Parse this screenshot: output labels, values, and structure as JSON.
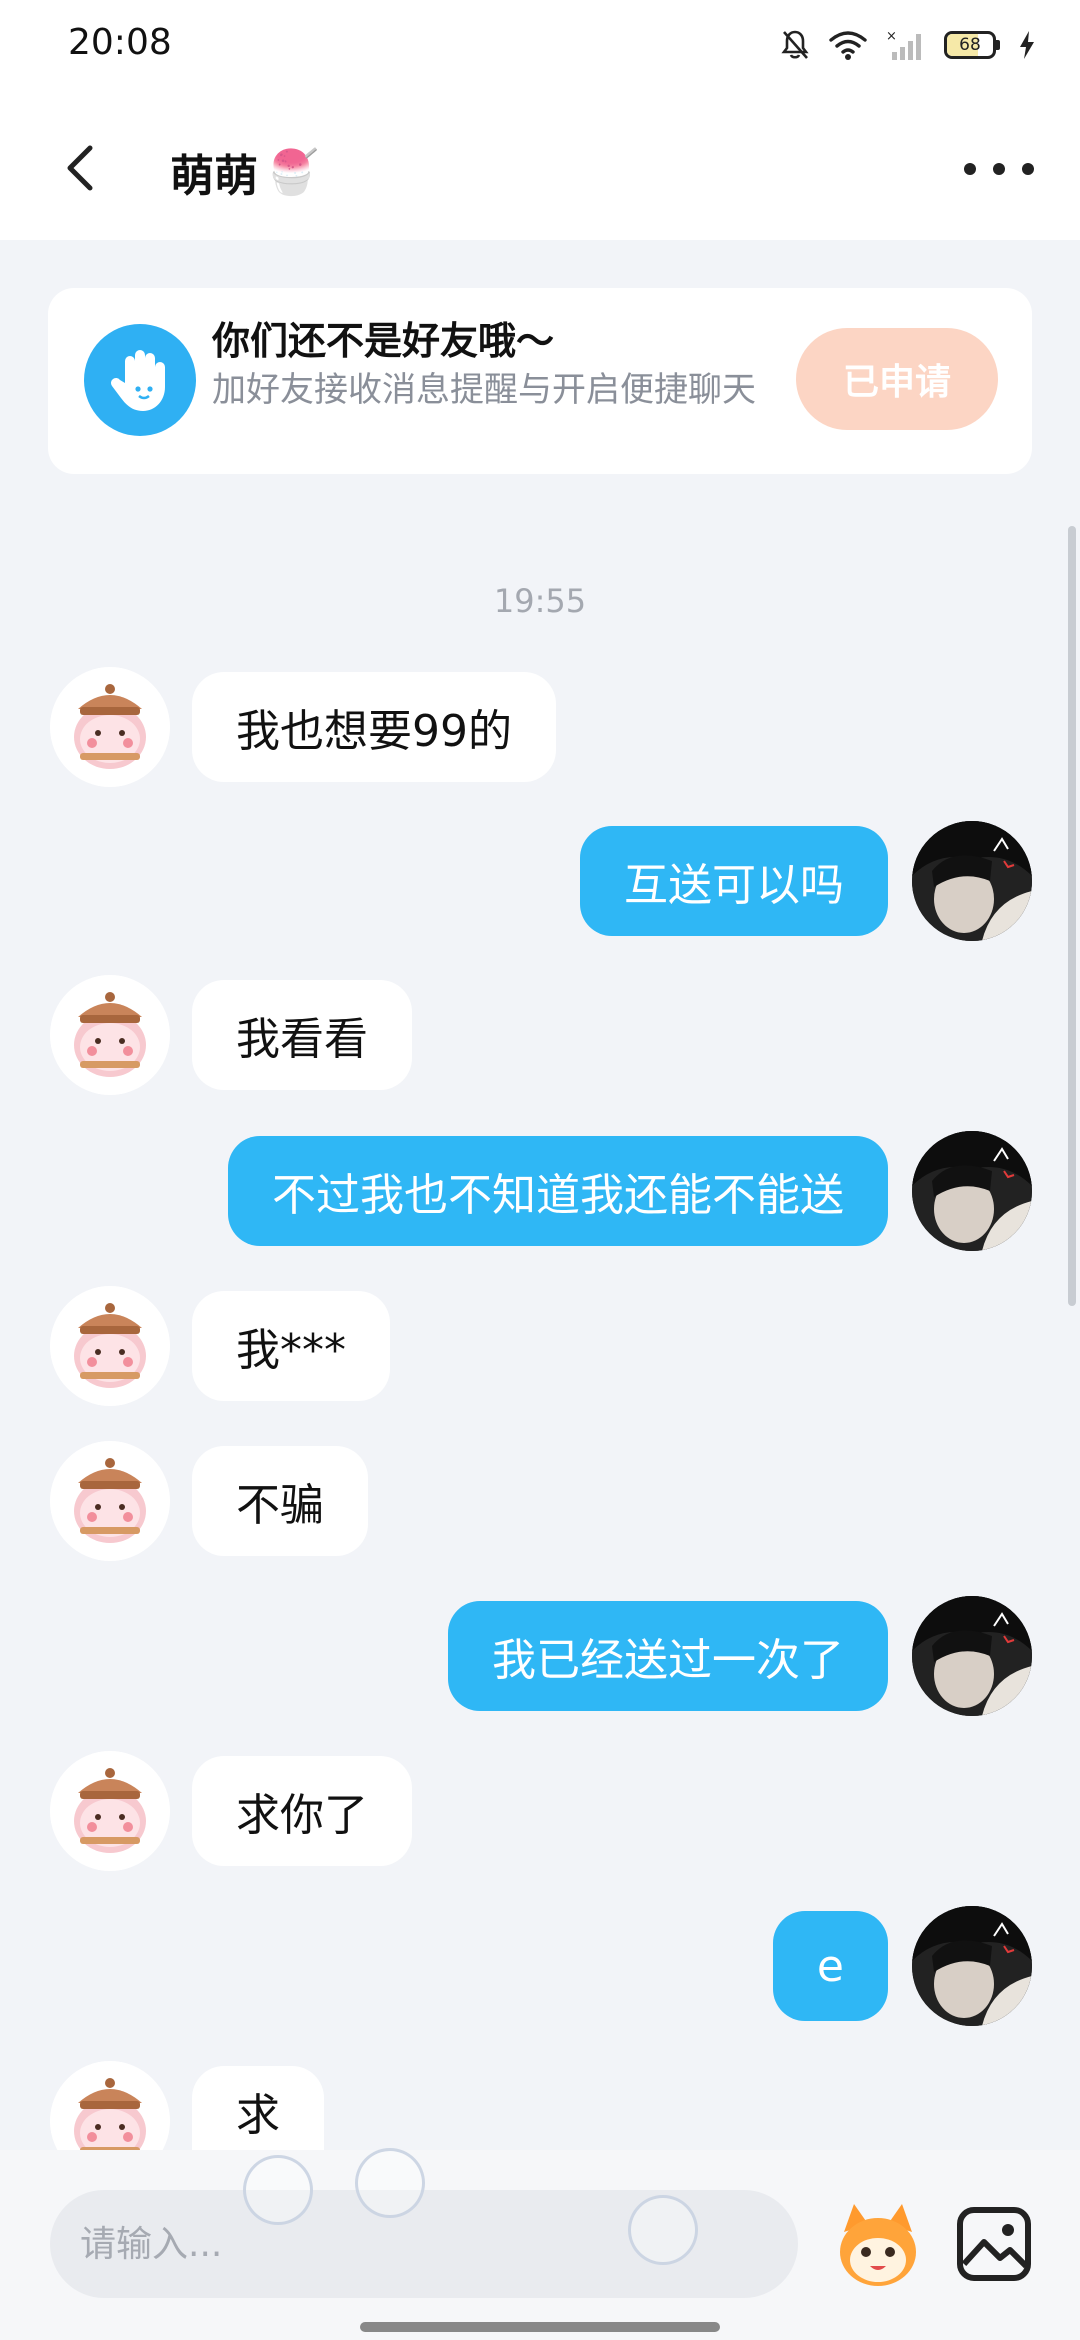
{
  "status_bar": {
    "time": "20:08",
    "battery": "68",
    "battery_level": 0.68
  },
  "header": {
    "title": "萌萌",
    "title_emoji": "🍧"
  },
  "friend_prompt": {
    "title": "你们还不是好友哦～",
    "subtitle": "加好友接收消息提醒与开启便捷聊天",
    "button": "已申请"
  },
  "timestamp": "19:55",
  "messages": [
    {
      "from": "other",
      "text": "我也想要99的"
    },
    {
      "from": "me",
      "text": "互送可以吗"
    },
    {
      "from": "other",
      "text": "我看看"
    },
    {
      "from": "me",
      "text": "不过我也不知道我还能不能送"
    },
    {
      "from": "other",
      "text": "我***"
    },
    {
      "from": "other",
      "text": "不骗"
    },
    {
      "from": "me",
      "text": "我已经送过一次了"
    },
    {
      "from": "other",
      "text": "求你了"
    },
    {
      "from": "me",
      "text": "e"
    },
    {
      "from": "other",
      "text": "求"
    }
  ],
  "input": {
    "placeholder": "请输入..."
  },
  "colors": {
    "accent": "#2fb7f5",
    "applied_button": "#fcd5c4",
    "background": "#f2f4f8"
  }
}
